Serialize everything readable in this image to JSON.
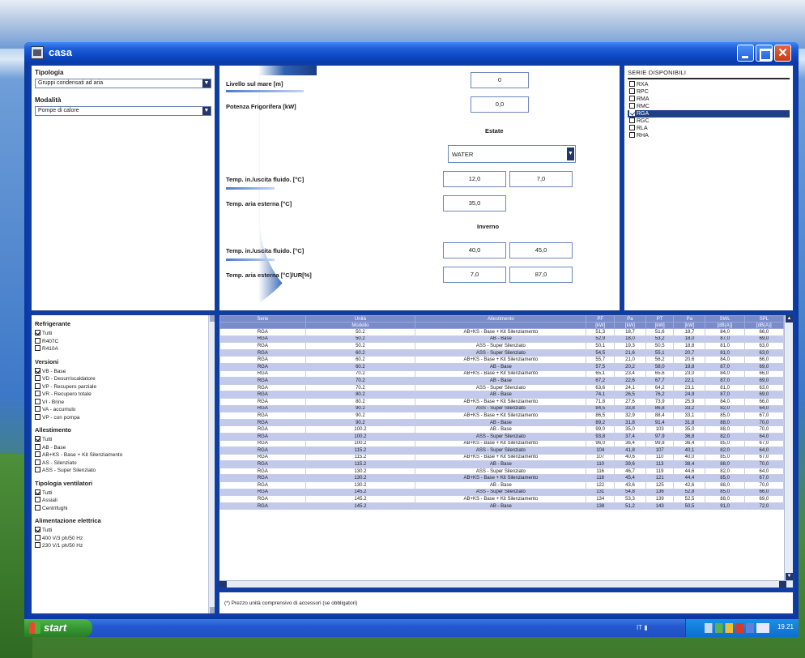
{
  "window": {
    "title": "casa"
  },
  "filters_top": {
    "tipologia_label": "Tipologia",
    "tipologia_value": "Gruppi condensati ad aria",
    "modalita_label": "Modalità",
    "modalita_value": "Pompe di calore"
  },
  "params": {
    "livello_label": "Livello sul mare [m]",
    "livello_value": "0",
    "potenza_label": "Potenza Frigorifera [kW]",
    "potenza_value": "0,0",
    "estate_label": "Estate",
    "fluid_value": "WATER",
    "estate_fluido_label": "Temp. in./uscita fluido. [°C]",
    "estate_fluido_in": "12,0",
    "estate_fluido_out": "7,0",
    "estate_aria_label": "Temp. aria esterna [°C]",
    "estate_aria_value": "35,0",
    "inverno_label": "Inverno",
    "inverno_fluido_label": "Temp. in./uscita fluido. [°C]",
    "inverno_fluido_in": "40,0",
    "inverno_fluido_out": "45,0",
    "inverno_aria_label": "Temp. aria esterna [°C]/UR[%]",
    "inverno_aria_temp": "7,0",
    "inverno_aria_ur": "87,0"
  },
  "series": {
    "title": "SERIE DISPONIBILI",
    "items": [
      {
        "label": "RXA",
        "checked": false,
        "selected": false
      },
      {
        "label": "RPC",
        "checked": false,
        "selected": false
      },
      {
        "label": "RMA",
        "checked": false,
        "selected": false
      },
      {
        "label": "RMC",
        "checked": false,
        "selected": false
      },
      {
        "label": "RGA",
        "checked": true,
        "selected": true
      },
      {
        "label": "RGC",
        "checked": false,
        "selected": false
      },
      {
        "label": "RLA",
        "checked": false,
        "selected": false
      },
      {
        "label": "RHA",
        "checked": false,
        "selected": false
      }
    ]
  },
  "filters_bottom": {
    "groups": [
      {
        "title": "Refrigerante",
        "items": [
          {
            "label": "Tutti",
            "checked": true
          },
          {
            "label": "R407C",
            "checked": false
          },
          {
            "label": "R410A",
            "checked": false
          }
        ]
      },
      {
        "title": "Versioni",
        "items": [
          {
            "label": "VB - Base",
            "checked": true
          },
          {
            "label": "VD - Desurriscaldatore",
            "checked": false
          },
          {
            "label": "VP - Recupero parziale",
            "checked": false
          },
          {
            "label": "VR - Recupero totale",
            "checked": false
          },
          {
            "label": "VI - Brine",
            "checked": false
          },
          {
            "label": "VA - accumulo",
            "checked": false
          },
          {
            "label": "VP - con pompa",
            "checked": false
          }
        ]
      },
      {
        "title": "Allestimento",
        "items": [
          {
            "label": "Tutti",
            "checked": true
          },
          {
            "label": "AB - Base",
            "checked": false
          },
          {
            "label": "AB+KS - Base + Kit Silenziamento",
            "checked": false
          },
          {
            "label": "AS - Silenziato",
            "checked": false
          },
          {
            "label": "ASS - Super Silenziato",
            "checked": false
          }
        ]
      },
      {
        "title": "Tipologia ventilatori",
        "items": [
          {
            "label": "Tutti",
            "checked": true
          },
          {
            "label": "Assiali",
            "checked": false
          },
          {
            "label": "Centrifughi",
            "checked": false
          }
        ]
      },
      {
        "title": "Alimentazione elettrica",
        "items": [
          {
            "label": "Tutti",
            "checked": true
          },
          {
            "label": "400 V/3 ph/50 Hz",
            "checked": false
          },
          {
            "label": "230 V/1 ph/50 Hz",
            "checked": false
          }
        ]
      }
    ]
  },
  "table": {
    "headers": [
      "Serie",
      "Unità",
      "Allestimento",
      "PF",
      "Pa",
      "PT",
      "Pa",
      "SWL",
      "SPL"
    ],
    "subheaders": [
      "",
      "Modello",
      "",
      "[kW]",
      "[kW]",
      "[kW]",
      "[kW]",
      "[dB(A)]",
      "[dB(A)]"
    ],
    "rows": [
      [
        "RGA",
        "50.2",
        "AB+KS - Base + Kit Silenziamento",
        "51,3",
        "18,7",
        "51,6",
        "18,7",
        "84,0",
        "66,0"
      ],
      [
        "RGA",
        "50.2",
        "AB - Base",
        "52,9",
        "18,0",
        "53,2",
        "18,0",
        "87,0",
        "69,0"
      ],
      [
        "RGA",
        "50.2",
        "ASS - Super Silenziato",
        "50,1",
        "19,3",
        "50,5",
        "18,8",
        "81,0",
        "63,0"
      ],
      [
        "RGA",
        "60.2",
        "ASS - Super Silenziato",
        "54,5",
        "21,6",
        "55,1",
        "20,7",
        "81,0",
        "63,0"
      ],
      [
        "RGA",
        "60.2",
        "AB+KS - Base + Kit Silenziamento",
        "55,7",
        "21,0",
        "56,2",
        "20,6",
        "84,0",
        "66,0"
      ],
      [
        "RGA",
        "60.2",
        "AB - Base",
        "57,5",
        "20,2",
        "58,0",
        "19,8",
        "87,0",
        "69,0"
      ],
      [
        "RGA",
        "70.2",
        "AB+KS - Base + Kit Silenziamento",
        "65,1",
        "23,4",
        "65,6",
        "23,0",
        "84,0",
        "66,0"
      ],
      [
        "RGA",
        "70.2",
        "AB - Base",
        "67,2",
        "22,6",
        "67,7",
        "22,1",
        "87,0",
        "69,0"
      ],
      [
        "RGA",
        "70.2",
        "ASS - Super Silenziato",
        "63,6",
        "24,1",
        "64,2",
        "23,1",
        "81,0",
        "63,0"
      ],
      [
        "RGA",
        "80.2",
        "AB - Base",
        "74,1",
        "26,5",
        "76,2",
        "24,9",
        "87,0",
        "69,0"
      ],
      [
        "RGA",
        "80.2",
        "AB+KS - Base + Kit Silenziamento",
        "71,8",
        "27,6",
        "73,9",
        "25,9",
        "84,0",
        "66,0"
      ],
      [
        "RGA",
        "90.2",
        "ASS - Super Silenziato",
        "84,5",
        "33,8",
        "86,8",
        "33,2",
        "82,0",
        "64,0"
      ],
      [
        "RGA",
        "90.2",
        "AB+KS - Base + Kit Silenziamento",
        "86,5",
        "32,9",
        "88,4",
        "33,1",
        "85,0",
        "67,0"
      ],
      [
        "RGA",
        "90.2",
        "AB - Base",
        "89,2",
        "31,8",
        "91,4",
        "31,8",
        "88,0",
        "70,0"
      ],
      [
        "RGA",
        "100.2",
        "AB - Base",
        "99,0",
        "35,0",
        "103",
        "35,0",
        "88,0",
        "70,0"
      ],
      [
        "RGA",
        "100.2",
        "ASS - Super Silenziato",
        "93,8",
        "37,4",
        "97,9",
        "36,8",
        "82,0",
        "64,0"
      ],
      [
        "RGA",
        "100.2",
        "AB+KS - Base + Kit Silenziamento",
        "96,0",
        "36,4",
        "99,8",
        "36,4",
        "85,0",
        "67,0"
      ],
      [
        "RGA",
        "115.2",
        "ASS - Super Silenziato",
        "104",
        "41,8",
        "107",
        "40,1",
        "82,0",
        "64,0"
      ],
      [
        "RGA",
        "115.2",
        "AB+KS - Base + Kit Silenziamento",
        "107",
        "40,6",
        "110",
        "40,0",
        "85,0",
        "67,0"
      ],
      [
        "RGA",
        "115.2",
        "AB - Base",
        "110",
        "39,6",
        "113",
        "38,4",
        "88,0",
        "70,0"
      ],
      [
        "RGA",
        "130.2",
        "ASS - Super Silenziato",
        "116",
        "46,7",
        "119",
        "44,6",
        "82,0",
        "64,0"
      ],
      [
        "RGA",
        "130.2",
        "AB+KS - Base + Kit Silenziamento",
        "118",
        "45,4",
        "121",
        "44,4",
        "85,0",
        "67,0"
      ],
      [
        "RGA",
        "130.2",
        "AB - Base",
        "122",
        "43,6",
        "125",
        "42,6",
        "88,0",
        "70,0"
      ],
      [
        "RGA",
        "145.2",
        "ASS - Super Silenziato",
        "131",
        "54,8",
        "136",
        "52,8",
        "85,0",
        "66,0"
      ],
      [
        "RGA",
        "145.2",
        "AB+KS - Base + Kit Silenziamento",
        "134",
        "53,3",
        "139",
        "52,5",
        "88,0",
        "69,0"
      ],
      [
        "RGA",
        "145.2",
        "AB - Base",
        "138",
        "51,2",
        "143",
        "50,5",
        "91,0",
        "72,0"
      ]
    ]
  },
  "footer_note": "(*) Prezzo unità comprensivo di accessori (se obbligatori)",
  "taskbar": {
    "start_label": "start",
    "clock": "19.21"
  }
}
